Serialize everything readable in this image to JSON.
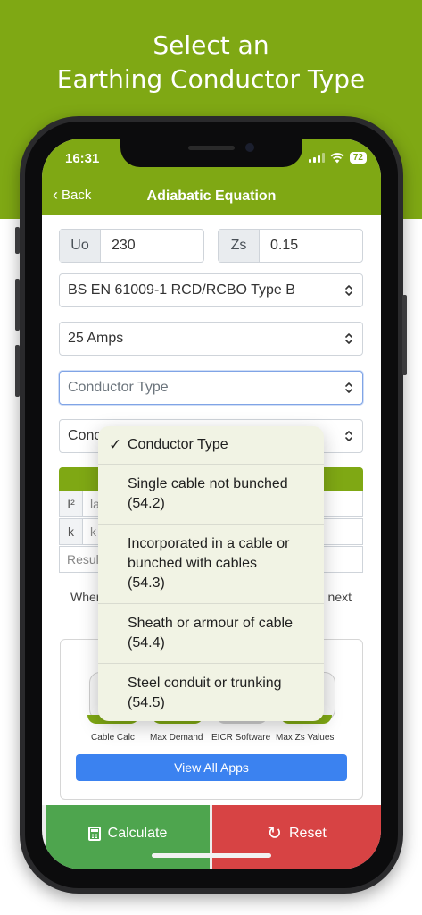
{
  "banner": {
    "line1": "Select an",
    "line2": "Earthing Conductor Type"
  },
  "status": {
    "time": "16:31",
    "battery": "72"
  },
  "nav": {
    "back_label": "Back",
    "title": "Adiabatic Equation"
  },
  "inputs": {
    "uo_label": "Uo",
    "uo_value": "230",
    "zs_label": "Zs",
    "zs_value": "0.15"
  },
  "selects": {
    "device": "BS EN 61009-1 RCD/RCBO Type B",
    "rating": "25 Amps",
    "conductor_type": "Conductor Type",
    "fifth_partial": "Conc"
  },
  "results": {
    "rows": [
      {
        "tag": "I²",
        "value": "la"
      },
      {
        "tag": "k",
        "value": "k"
      },
      {
        "tag": "",
        "value": "Resul"
      }
    ]
  },
  "note": {
    "left": "When",
    "right": "next"
  },
  "apps": {
    "labels": [
      "Cable Calc",
      "Max Demand",
      "EICR Software",
      "Max Zs Values"
    ],
    "badge_text": "Cable Calc",
    "view_all": "View All Apps"
  },
  "buttons": {
    "calculate": "Calculate",
    "reset": "Reset"
  },
  "dropdown": {
    "selected": "Conductor Type",
    "options": [
      {
        "line1": "Single cable not bunched",
        "line2": "(54.2)"
      },
      {
        "line1": "Incorporated in a cable or",
        "line2": "bunched with cables",
        "line3": "(54.3)"
      },
      {
        "line1": "Sheath or armour of cable",
        "line2": "(54.4)"
      },
      {
        "line1": "Steel conduit or trunking",
        "line2": "(54.5)"
      }
    ]
  },
  "colors": {
    "brand_green": "#7fa814",
    "calc_green": "#4ea54e",
    "reset_red": "#d74344",
    "link_blue": "#3b82f0"
  },
  "icons": [
    "chevron-left-icon",
    "signal-icon",
    "wifi-icon",
    "battery-icon",
    "updown-chevron-icon",
    "checkmark-icon",
    "calculator-icon",
    "refresh-icon"
  ]
}
